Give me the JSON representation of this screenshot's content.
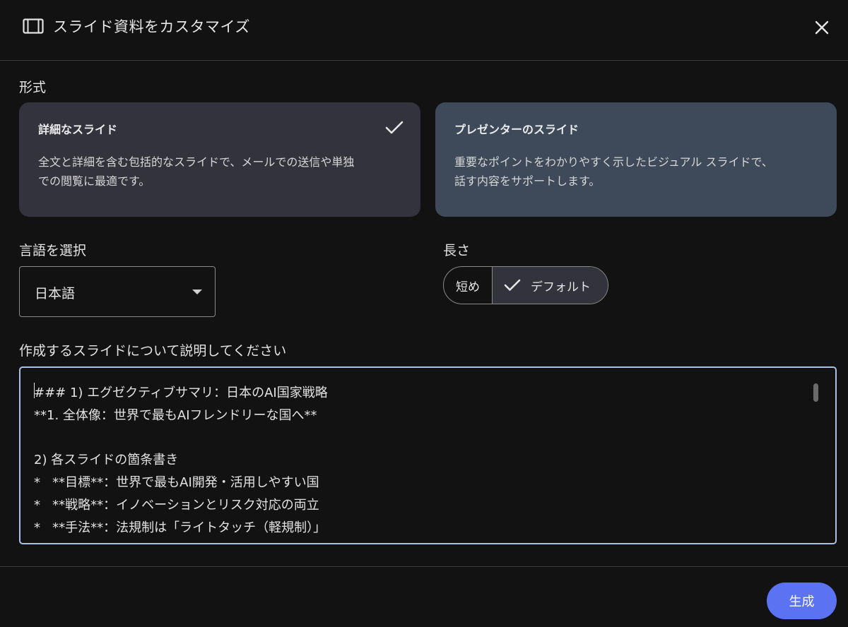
{
  "header": {
    "title": "スライド資料をカスタマイズ",
    "icon": "slides-icon",
    "close_icon": "close-icon"
  },
  "format": {
    "label": "形式",
    "options": [
      {
        "title": "詳細なスライド",
        "description_lines": [
          "全文と詳細を含む包括的なスライドで、メールでの送信や単独",
          "での閲覧に最適です。"
        ],
        "selected": true
      },
      {
        "title": "プレゼンターのスライド",
        "description_lines": [
          "重要なポイントをわかりやすく示したビジュアル スライドで、",
          "話す内容をサポートします。"
        ],
        "selected": false
      }
    ]
  },
  "language": {
    "label": "言語を選択",
    "selected": "日本語"
  },
  "length": {
    "label": "長さ",
    "options": [
      "短め",
      "デフォルト"
    ],
    "selected": "デフォルト"
  },
  "description": {
    "label": "作成するスライドについて説明してください",
    "lines": [
      "### 1) エグゼクティブサマリ：日本のAI国家戦略",
      "**1. 全体像：世界で最もAIフレンドリーな国へ**",
      "",
      "2) 各スライドの箇条書き",
      "*   **目標**：世界で最もAI開発・活用しやすい国",
      "*   **戦略**：イノベーションとリスク対応の両立",
      "*   **手法**：法規制は「ライトタッチ（軽規制）」"
    ]
  },
  "actions": {
    "generate_label": "生成"
  },
  "colors": {
    "background": "#121212",
    "selected_card": "#33333d",
    "other_card": "#3e4a5a",
    "focus_border": "#a8c0ea",
    "primary_button": "#5b73f2"
  }
}
